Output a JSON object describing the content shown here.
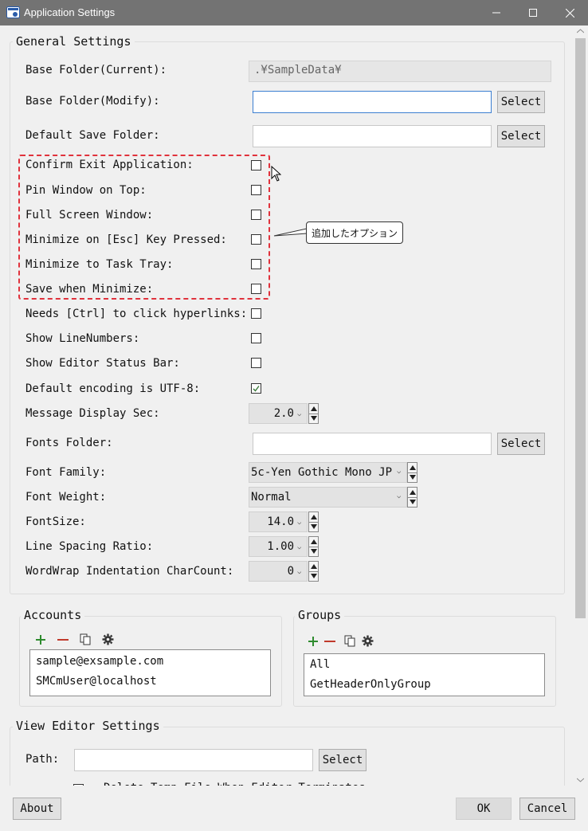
{
  "window": {
    "title": "Application Settings"
  },
  "general": {
    "title": "General Settings",
    "base_current_label": "Base Folder(Current):",
    "base_current_value": ".¥SampleData¥",
    "base_modify_label": "Base Folder(Modify):",
    "default_save_label": "Default Save Folder:",
    "select_label": "Select",
    "options": [
      {
        "label": "Confirm Exit Application:",
        "checked": false
      },
      {
        "label": "Pin Window on Top:",
        "checked": false
      },
      {
        "label": "Full Screen Window:",
        "checked": false
      },
      {
        "label": "Minimize on [Esc] Key Pressed:",
        "checked": false
      },
      {
        "label": "Minimize to Task Tray:",
        "checked": false
      },
      {
        "label": "Save when Minimize:",
        "checked": false
      },
      {
        "label": "Needs [Ctrl] to click hyperlinks:",
        "checked": false
      },
      {
        "label": "Show LineNumbers:",
        "checked": false
      },
      {
        "label": "Show Editor Status Bar:",
        "checked": false
      },
      {
        "label": "Default encoding is UTF-8:",
        "checked": true
      }
    ],
    "callout_text": "追加したオプション",
    "message_sec_label": "Message Display Sec:",
    "message_sec_value": "2.0",
    "fonts_folder_label": "Fonts Folder:",
    "font_family_label": "Font Family:",
    "font_family_value": "5c-Yen Gothic Mono JP",
    "font_weight_label": "Font Weight:",
    "font_weight_value": "Normal",
    "font_size_label": "FontSize:",
    "font_size_value": "14.0",
    "line_spacing_label": "Line  Spacing  Ratio:",
    "line_spacing_value": "1.00",
    "wordwrap_label": "WordWrap Indentation CharCount:",
    "wordwrap_value": "0"
  },
  "accounts": {
    "title": "Accounts",
    "items": [
      "sample@exsample.com",
      "SMCmUser@localhost"
    ]
  },
  "groups": {
    "title": "Groups",
    "items": [
      "All",
      "GetHeaderOnlyGroup"
    ]
  },
  "view_editor": {
    "title": "View Editor Settings",
    "path_label": "Path:",
    "select_label": "Select",
    "delete_temp_label": "Delete Temp File When Editor Terminates"
  },
  "footer": {
    "about_label": "About",
    "ok_label": "OK",
    "cancel_label": "Cancel"
  },
  "colors": {
    "titlebar": "#737373",
    "highlight_dash": "#e0323c",
    "add_icon": "#2e8b2e",
    "remove_icon": "#c0392b"
  }
}
